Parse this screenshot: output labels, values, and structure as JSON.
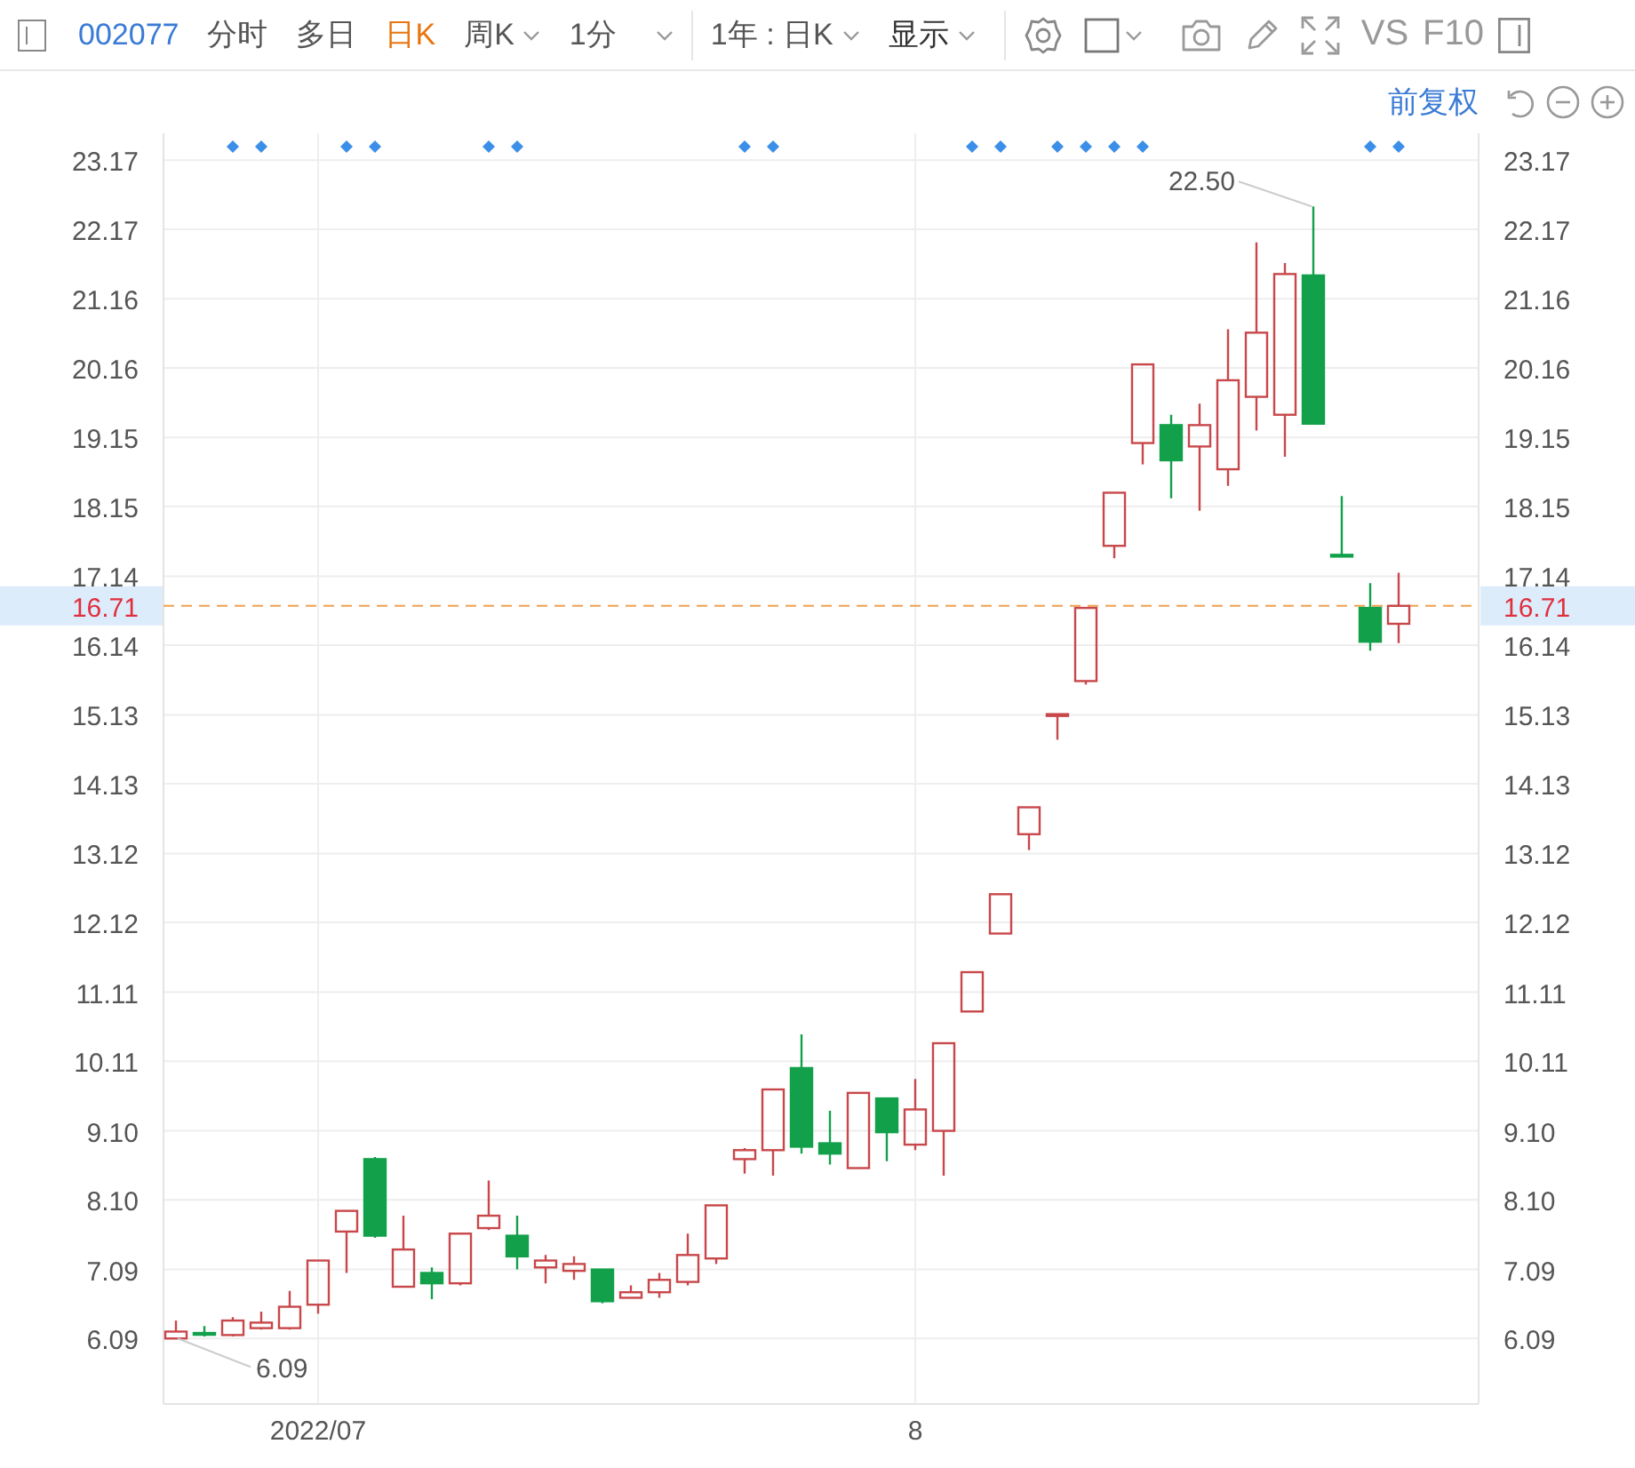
{
  "toolbar": {
    "code": "002077",
    "tabs": [
      {
        "label": "分时",
        "selected": false,
        "dropdown": false
      },
      {
        "label": "多日",
        "selected": false,
        "dropdown": false
      },
      {
        "label": "日K",
        "selected": true,
        "dropdown": false
      },
      {
        "label": "周K",
        "selected": false,
        "dropdown": true
      },
      {
        "label": "1分",
        "selected": false,
        "dropdown": true
      }
    ],
    "range": {
      "label": "1年 : 日K"
    },
    "display": {
      "label": "显示"
    },
    "buttons": [
      "VS",
      "F10"
    ]
  },
  "adjust_mode": {
    "label": "前复权"
  },
  "chart": {
    "event_marks": [
      false,
      false,
      true,
      true,
      false,
      false,
      true,
      true,
      false,
      false,
      false,
      true,
      true,
      false,
      false,
      false,
      false,
      false,
      false,
      false,
      true,
      true,
      false,
      false,
      false,
      false,
      false,
      false,
      true,
      true,
      false,
      true,
      true,
      true,
      true,
      false,
      false,
      false,
      false,
      false,
      false,
      false,
      true,
      true
    ],
    "chart_data": {
      "type": "candlestick",
      "grid": true,
      "categories": [
        null,
        null,
        null,
        null,
        null,
        "2022/07",
        null,
        null,
        null,
        null,
        null,
        null,
        null,
        null,
        null,
        null,
        null,
        null,
        null,
        null,
        null,
        null,
        null,
        null,
        null,
        null,
        "8",
        null,
        null,
        null,
        null,
        null,
        null,
        null,
        null,
        null,
        null,
        null,
        null,
        null,
        null,
        null,
        null,
        null
      ],
      "ylim": [
        5.14,
        23.56
      ],
      "ohlc": [
        [
          6.09,
          6.35,
          6.09,
          6.19
        ],
        [
          6.17,
          6.27,
          6.12,
          6.16
        ],
        [
          6.14,
          6.4,
          6.12,
          6.35
        ],
        [
          6.24,
          6.48,
          6.22,
          6.32
        ],
        [
          6.24,
          6.78,
          6.22,
          6.55
        ],
        [
          6.58,
          7.22,
          6.45,
          7.22
        ],
        [
          7.64,
          7.94,
          7.04,
          7.94
        ],
        [
          8.69,
          8.72,
          7.55,
          7.58
        ],
        [
          6.84,
          7.87,
          6.84,
          7.38
        ],
        [
          7.04,
          7.12,
          6.66,
          6.89
        ],
        [
          6.89,
          7.61,
          6.86,
          7.61
        ],
        [
          7.69,
          8.38,
          7.66,
          7.87
        ],
        [
          7.58,
          7.87,
          7.09,
          7.28
        ],
        [
          7.12,
          7.3,
          6.89,
          7.22
        ],
        [
          7.07,
          7.28,
          6.94,
          7.17
        ],
        [
          7.09,
          7.09,
          6.6,
          6.63
        ],
        [
          6.68,
          6.86,
          6.68,
          6.76
        ],
        [
          6.76,
          7.04,
          6.68,
          6.94
        ],
        [
          6.91,
          7.61,
          6.86,
          7.3
        ],
        [
          7.25,
          8.02,
          7.17,
          8.02
        ],
        [
          8.69,
          8.85,
          8.48,
          8.82
        ],
        [
          8.82,
          9.7,
          8.45,
          9.7
        ],
        [
          10.01,
          10.5,
          8.77,
          8.87
        ],
        [
          8.92,
          9.39,
          8.61,
          8.77
        ],
        [
          8.56,
          9.65,
          8.56,
          9.65
        ],
        [
          9.57,
          9.57,
          8.66,
          9.08
        ],
        [
          8.9,
          9.85,
          8.82,
          9.41
        ],
        [
          9.1,
          10.37,
          8.45,
          10.37
        ],
        [
          10.83,
          11.4,
          10.83,
          11.4
        ],
        [
          11.96,
          12.53,
          11.96,
          12.53
        ],
        [
          13.4,
          13.79,
          13.17,
          13.79
        ],
        [
          15.13,
          15.14,
          14.77,
          15.14
        ],
        [
          15.62,
          16.68,
          15.57,
          16.68
        ],
        [
          17.58,
          18.35,
          17.4,
          18.35
        ],
        [
          19.07,
          20.21,
          18.76,
          20.21
        ],
        [
          19.33,
          19.48,
          18.27,
          18.82
        ],
        [
          19.02,
          19.64,
          18.09,
          19.33
        ],
        [
          18.69,
          20.72,
          18.45,
          19.98
        ],
        [
          19.74,
          21.98,
          19.25,
          20.67
        ],
        [
          19.48,
          21.68,
          18.87,
          21.52
        ],
        [
          21.5,
          22.5,
          19.35,
          19.35
        ],
        [
          17.45,
          18.3,
          17.44,
          17.44
        ],
        [
          16.68,
          17.04,
          16.06,
          16.19
        ],
        [
          16.45,
          17.19,
          16.17,
          16.71
        ]
      ],
      "yticks": [
        {
          "value": 23.17,
          "label": "23.17"
        },
        {
          "value": 22.17,
          "label": "22.17"
        },
        {
          "value": 21.16,
          "label": "21.16"
        },
        {
          "value": 20.16,
          "label": "20.16"
        },
        {
          "value": 19.15,
          "label": "19.15"
        },
        {
          "value": 18.15,
          "label": "18.15"
        },
        {
          "value": 17.14,
          "label": "17.14"
        },
        {
          "value": 16.14,
          "label": "16.14"
        },
        {
          "value": 15.13,
          "label": "15.13"
        },
        {
          "value": 14.13,
          "label": "14.13"
        },
        {
          "value": 13.12,
          "label": "13.12"
        },
        {
          "value": 12.12,
          "label": "12.12"
        },
        {
          "value": 11.11,
          "label": "11.11"
        },
        {
          "value": 10.11,
          "label": "10.11"
        },
        {
          "value": 9.1,
          "label": "9.10"
        },
        {
          "value": 8.1,
          "label": "8.10"
        },
        {
          "value": 7.09,
          "label": "7.09"
        },
        {
          "value": 6.09,
          "label": "6.09"
        }
      ],
      "ref_lines": [
        {
          "axis": "y",
          "value": 16.71,
          "label": "16.71"
        }
      ],
      "annotations": [
        "6.09",
        "22.50"
      ]
    }
  }
}
